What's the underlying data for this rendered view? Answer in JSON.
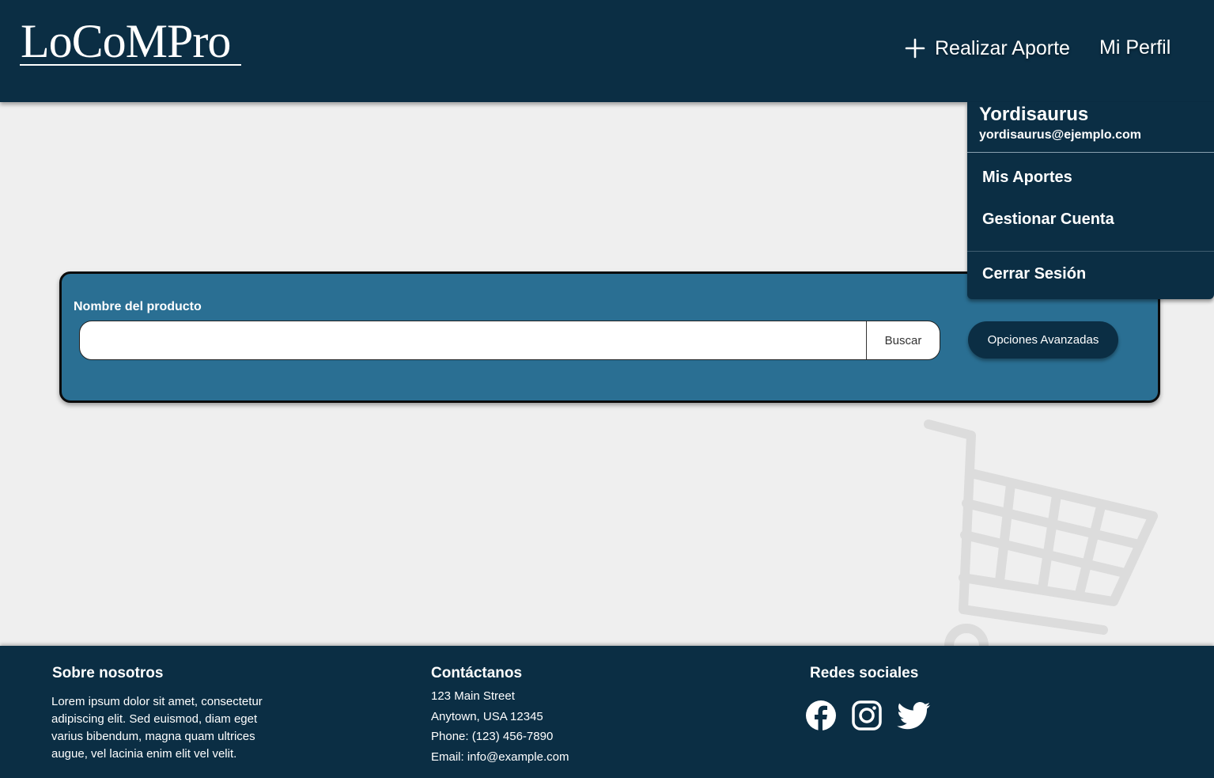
{
  "header": {
    "logo": "LoCoMPro",
    "aporte_label": "Realizar Aporte",
    "perfil_label": "Mi Perfil"
  },
  "dropdown": {
    "user_name": "Yordisaurus",
    "user_email": "yordisaurus@ejemplo.com",
    "items": [
      "Mis Aportes",
      "Gestionar Cuenta"
    ],
    "logout": "Cerrar Sesión"
  },
  "search": {
    "label": "Nombre del producto",
    "value": "",
    "placeholder": "",
    "button": "Buscar",
    "advanced_button": "Opciones Avanzadas"
  },
  "footer": {
    "about_title": "Sobre nosotros",
    "about_lines": [
      "Lorem ipsum dolor sit amet, consectetur",
      "adipiscing elit. Sed euismod, diam eget",
      "varius bibendum, magna quam ultrices",
      "augue, vel lacinia enim elit vel velit."
    ],
    "contact_title": "Contáctanos",
    "contact_lines": [
      "123 Main Street",
      "Anytown, USA 12345",
      "Phone: (123) 456-7890",
      "Email: info@example.com"
    ],
    "social_title": "Redes sociales",
    "social_icons": [
      "facebook-icon",
      "instagram-icon",
      "twitter-icon"
    ]
  },
  "colors": {
    "primary": "#0b2e44",
    "panel": "#2a6f93",
    "background": "#efefef"
  }
}
